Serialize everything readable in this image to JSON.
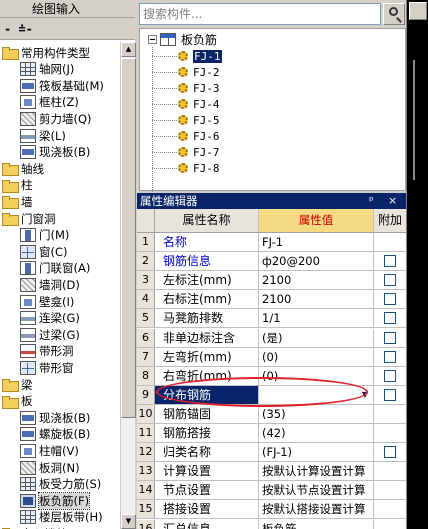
{
  "left_panel": {
    "title": "绘图输入",
    "toolbar_text": "- ≐-",
    "tree": [
      {
        "label": "常用构件类型",
        "level": 0,
        "icon": "folder"
      },
      {
        "label": "轴网(J)",
        "level": 1,
        "icon": "grid"
      },
      {
        "label": "筏板基础(M)",
        "level": 1,
        "icon": "slab"
      },
      {
        "label": "框柱(Z)",
        "level": 1,
        "icon": "block"
      },
      {
        "label": "剪力墙(Q)",
        "level": 1,
        "icon": "wall"
      },
      {
        "label": "梁(L)",
        "level": 1,
        "icon": "beam"
      },
      {
        "label": "现浇板(B)",
        "level": 1,
        "icon": "slab"
      },
      {
        "label": "轴线",
        "level": 0,
        "icon": "folder"
      },
      {
        "label": "柱",
        "level": 0,
        "icon": "folder"
      },
      {
        "label": "墙",
        "level": 0,
        "icon": "folder"
      },
      {
        "label": "门窗洞",
        "level": 0,
        "icon": "folder"
      },
      {
        "label": "门(M)",
        "level": 1,
        "icon": "door"
      },
      {
        "label": "窗(C)",
        "level": 1,
        "icon": "win"
      },
      {
        "label": "门联窗(A)",
        "level": 1,
        "icon": "door"
      },
      {
        "label": "墙洞(D)",
        "level": 1,
        "icon": "wall"
      },
      {
        "label": "壁龛(I)",
        "level": 1,
        "icon": "block"
      },
      {
        "label": "连梁(G)",
        "level": 1,
        "icon": "beam"
      },
      {
        "label": "过梁(G)",
        "level": 1,
        "icon": "beam"
      },
      {
        "label": "带形洞",
        "level": 1,
        "icon": "strip"
      },
      {
        "label": "带形窗",
        "level": 1,
        "icon": "win"
      },
      {
        "label": "梁",
        "level": 0,
        "icon": "folder"
      },
      {
        "label": "板",
        "level": 0,
        "icon": "folder"
      },
      {
        "label": "现浇板(B)",
        "level": 1,
        "icon": "slab"
      },
      {
        "label": "螺旋板(B)",
        "level": 1,
        "icon": "slab"
      },
      {
        "label": "柱帽(V)",
        "level": 1,
        "icon": "block"
      },
      {
        "label": "板洞(N)",
        "level": 1,
        "icon": "wall"
      },
      {
        "label": "板受力筋(S)",
        "level": 1,
        "icon": "grid"
      },
      {
        "label": "板负筋(F)",
        "level": 1,
        "icon": "sel",
        "selected": true
      },
      {
        "label": "楼层板带(H)",
        "level": 1,
        "icon": "grid"
      },
      {
        "label": "空心楼盖",
        "level": 0,
        "icon": "folder"
      }
    ]
  },
  "search": {
    "placeholder": "搜索构件..."
  },
  "component_tree": {
    "root": "板负筋",
    "items": [
      "FJ-1",
      "FJ-2",
      "FJ-3",
      "FJ-4",
      "FJ-5",
      "FJ-6",
      "FJ-7",
      "FJ-8"
    ],
    "selected_index": 0
  },
  "property_editor": {
    "title": "属性编辑器",
    "pin_icon": "pin-icon",
    "close_icon": "close-icon",
    "headers": {
      "name": "属性名称",
      "value": "属性值",
      "extra": "附加"
    },
    "rows": [
      {
        "num": "1",
        "name": "名称",
        "value": "FJ-1",
        "blue": true,
        "checkbox": false
      },
      {
        "num": "2",
        "name": "钢筋信息",
        "value": "ф20@200",
        "blue": true,
        "checkbox": true
      },
      {
        "num": "3",
        "name": "左标注(mm)",
        "value": "2100",
        "blue": false,
        "checkbox": true
      },
      {
        "num": "4",
        "name": "右标注(mm)",
        "value": "2100",
        "blue": false,
        "checkbox": true
      },
      {
        "num": "5",
        "name": "马凳筋排数",
        "value": "1/1",
        "blue": false,
        "checkbox": true
      },
      {
        "num": "6",
        "name": "非单边标注含",
        "value": "(是)",
        "blue": false,
        "checkbox": true
      },
      {
        "num": "7",
        "name": "左弯折(mm)",
        "value": "(0)",
        "blue": false,
        "checkbox": true
      },
      {
        "num": "8",
        "name": "右弯折(mm)",
        "value": "(0)",
        "blue": false,
        "checkbox": true
      },
      {
        "num": "9",
        "name": "分布钢筋",
        "value": "",
        "blue": false,
        "checkbox": true,
        "selected": true
      },
      {
        "num": "10",
        "name": "钢筋锚固",
        "value": "(35)",
        "blue": false,
        "checkbox": false
      },
      {
        "num": "11",
        "name": "钢筋搭接",
        "value": "(42)",
        "blue": false,
        "checkbox": false
      },
      {
        "num": "12",
        "name": "归类名称",
        "value": "(FJ-1)",
        "blue": false,
        "checkbox": true
      },
      {
        "num": "13",
        "name": "计算设置",
        "value": "按默认计算设置计算",
        "blue": false,
        "checkbox": false
      },
      {
        "num": "14",
        "name": "节点设置",
        "value": "按默认节点设置计算",
        "blue": false,
        "checkbox": false
      },
      {
        "num": "15",
        "name": "搭接设置",
        "value": "按默认搭接设置计算",
        "blue": false,
        "checkbox": false
      },
      {
        "num": "16",
        "name": "汇总信息",
        "value": "板负筋",
        "blue": false,
        "checkbox": false
      }
    ]
  },
  "colors": {
    "highlight": "#e0202a",
    "titlebar": "#0a246a",
    "header_value_bg": "#f5d983"
  }
}
